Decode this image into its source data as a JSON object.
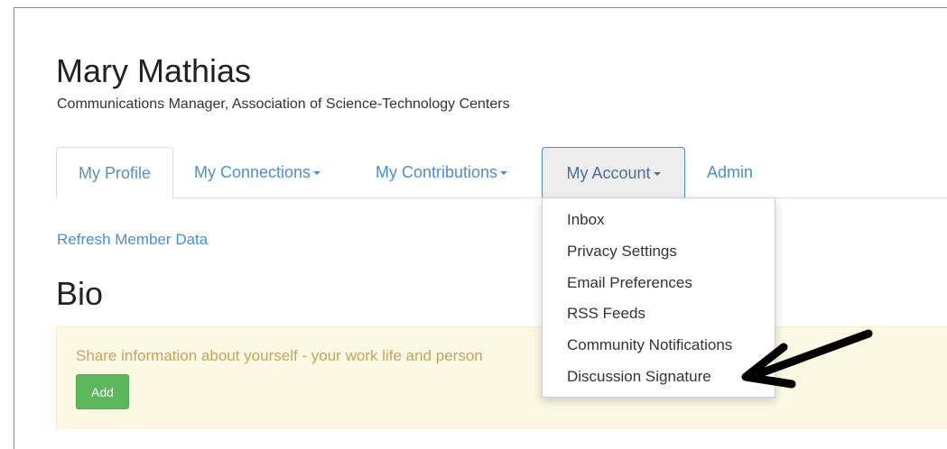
{
  "profile": {
    "name": "Mary Mathias",
    "title": "Communications Manager, Association of Science-Technology Centers"
  },
  "tabs": {
    "profile": "My Profile",
    "connections": "My Connections",
    "contributions": "My Contributions",
    "account": "My Account",
    "admin": "Admin"
  },
  "links": {
    "refresh": "Refresh Member Data"
  },
  "bio": {
    "heading": "Bio",
    "prompt": "Share information about yourself - your work life and person",
    "add_label": "Add"
  },
  "account_menu": {
    "items": [
      "Inbox",
      "Privacy Settings",
      "Email Preferences",
      "RSS Feeds",
      "Community Notifications",
      "Discussion Signature"
    ]
  },
  "colors": {
    "link": "#4a8fd1",
    "alert_bg": "#fcf8e3",
    "alert_text": "#c4a45c",
    "add_button": "#5cb85c"
  },
  "icons": {
    "caret": "caret-down-icon",
    "annotation": "pointer-arrow-icon"
  }
}
